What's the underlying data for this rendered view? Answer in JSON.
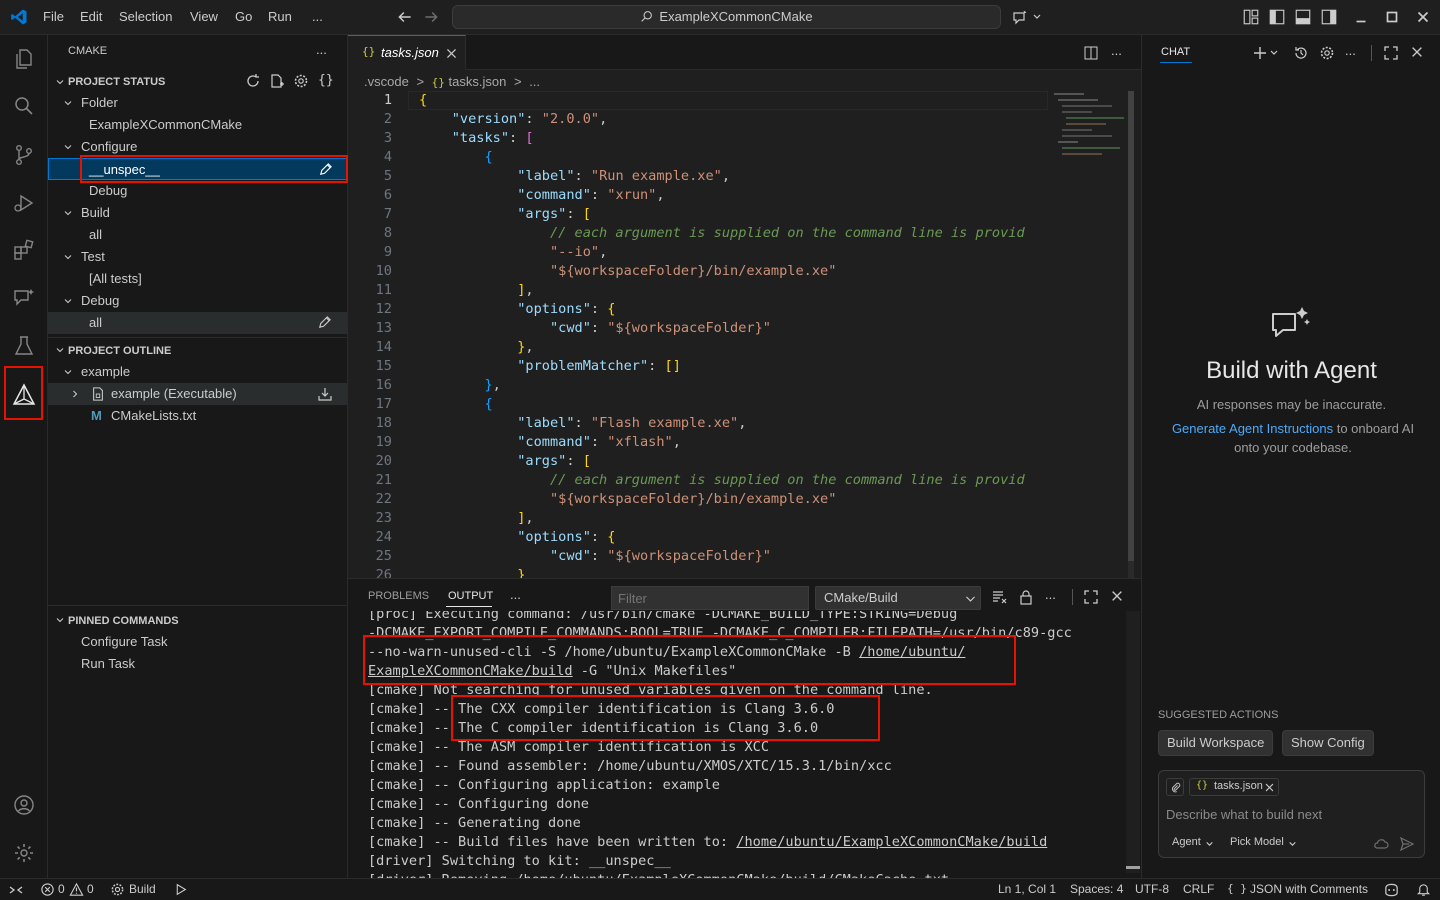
{
  "titlebar": {
    "menu": [
      "File",
      "Edit",
      "Selection",
      "View",
      "Go",
      "Run",
      "..."
    ],
    "search_text": "ExampleXCommonCMake"
  },
  "sidebar": {
    "header": "CMAKE",
    "more": "...",
    "project_status": {
      "title": "PROJECT STATUS",
      "folder_label": "Folder",
      "folder_value": "ExampleXCommonCMake",
      "configure_label": "Configure",
      "configure_preset": "__unspec__",
      "configure_type": "Debug",
      "build_label": "Build",
      "build_target": "all",
      "test_label": "Test",
      "test_value": "[All tests]",
      "debug_label": "Debug",
      "debug_target": "all"
    },
    "project_outline": {
      "title": "PROJECT OUTLINE",
      "project": "example",
      "target": "example (Executable)",
      "file": "CMakeLists.txt"
    },
    "pinned": {
      "title": "PINNED COMMANDS",
      "items": [
        "Configure Task",
        "Run Task"
      ]
    }
  },
  "editor": {
    "tab_label": "tasks.json",
    "tab_icon": "{}",
    "breadcrumb": [
      ".vscode",
      "tasks.json",
      "..."
    ],
    "breadcrumb_sep": ">",
    "line_numbers": [
      "1",
      "2",
      "3",
      "4",
      "5",
      "6",
      "7",
      "8",
      "9",
      "10",
      "11",
      "12",
      "13",
      "14",
      "15",
      "16",
      "17",
      "18",
      "19",
      "20",
      "21",
      "22",
      "23",
      "24",
      "25",
      "26"
    ],
    "code": {
      "version_key": "\"version\"",
      "version_val": "\"2.0.0\"",
      "tasks_key": "\"tasks\"",
      "label_key": "\"label\"",
      "label1": "\"Run example.xe\"",
      "command_key": "\"command\"",
      "command1": "\"xrun\"",
      "args_key": "\"args\"",
      "comment": "// each argument is supplied on the command line is provid",
      "io": "\"--io\"",
      "exe_path": "\"${workspaceFolder}/bin/example.xe\"",
      "options_key": "\"options\"",
      "cwd_key": "\"cwd\"",
      "cwd_val": "\"${workspaceFolder}\"",
      "pm_key": "\"problemMatcher\"",
      "label2": "\"Flash example.xe\"",
      "command2": "\"xflash\""
    }
  },
  "panel": {
    "tabs": [
      "PROBLEMS",
      "OUTPUT",
      "..."
    ],
    "filter_placeholder": "Filter",
    "channel": "CMake/Build",
    "lines": [
      "[proc] Executing command: /usr/bin/cmake -DCMAKE_BUILD_TYPE:STRING=Debug",
      "-DCMAKE_EXPORT_COMPILE_COMMANDS:BOOL=TRUE -DCMAKE_C_COMPILER:FILEPATH=/usr/bin/c89-gcc",
      "--no-warn-unused-cli -S /home/ubuntu/ExampleXCommonCMake -B ",
      "/home/ubuntu/",
      "ExampleXCommonCMake/build",
      " -G \"Unix Makefiles\"",
      "[cmake] Not searching for unused variables given on the command line.",
      "[cmake] -- The CXX compiler identification is Clang 3.6.0",
      "[cmake] -- The C compiler identification is Clang 3.6.0",
      "[cmake] -- The ASM compiler identification is XCC",
      "[cmake] -- Found assembler: /home/ubuntu/XMOS/XTC/15.3.1/bin/xcc",
      "[cmake] -- Configuring application: example",
      "[cmake] -- Configuring done",
      "[cmake] -- Generating done",
      "[cmake] -- Build files have been written to: ",
      "/home/ubuntu/ExampleXCommonCMake/build",
      "[driver] Switching to kit: __unspec__",
      "[driver] Removing /home/ubuntu/ExampleXCommonCMake/build/CMakeCache.txt"
    ]
  },
  "chat": {
    "title": "CHAT",
    "heading": "Build with Agent",
    "disclaimer": "AI responses may be inaccurate.",
    "link": "Generate Agent Instructions",
    "onboard_text": "to onboard AI onto your codebase.",
    "suggested_title": "SUGGESTED ACTIONS",
    "suggestions": [
      "Build Workspace",
      "Show Config"
    ],
    "attachment": "tasks.json",
    "input_placeholder": "Describe what to build next",
    "mode": "Agent",
    "model": "Pick Model"
  },
  "statusbar": {
    "errors": "0",
    "warnings": "0",
    "build": "Build",
    "position": "Ln 1, Col 1",
    "spaces": "Spaces: 4",
    "encoding": "UTF-8",
    "eol": "CRLF",
    "language": "JSON with Comments",
    "language_icon": "{ }"
  },
  "colors": {
    "accent": "#0078d4",
    "highlight_box": "#e51400",
    "selection": "#04395e",
    "link": "#4daafc"
  }
}
